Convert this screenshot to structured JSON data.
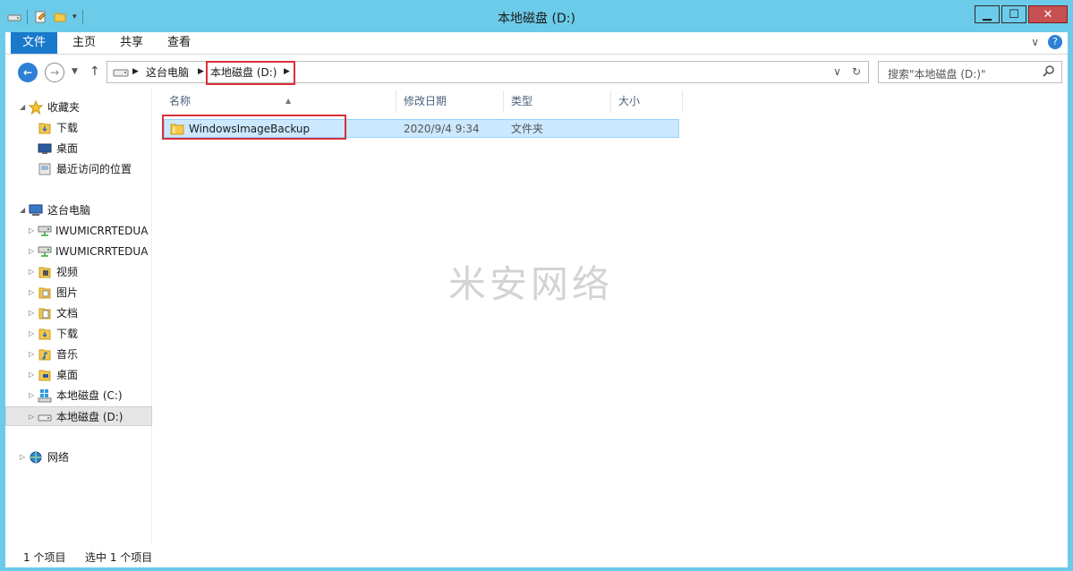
{
  "window": {
    "title": "本地磁盘 (D:)",
    "controls": {
      "minimize": "▁",
      "maximize": "☐",
      "close": "✕"
    }
  },
  "colors": {
    "titlebar": "#6ccbe8",
    "file_tab": "#1979ca",
    "selection": "#cce8ff",
    "highlight": "#d8303a"
  },
  "ribbon": {
    "tabs": [
      {
        "label": "文件",
        "active": true
      },
      {
        "label": "主页"
      },
      {
        "label": "共享"
      },
      {
        "label": "查看"
      }
    ],
    "expand_glyph": "∨",
    "help_glyph": "?"
  },
  "address": {
    "crumbs": [
      "这台电脑",
      "本地磁盘 (D:)"
    ],
    "search_placeholder": "搜索\"本地磁盘 (D:)\"",
    "dropdown_glyph": "∨",
    "refresh_glyph": "↻"
  },
  "sidebar": {
    "favorites": {
      "label": "收藏夹",
      "items": [
        "下载",
        "桌面",
        "最近访问的位置"
      ]
    },
    "this_pc": {
      "label": "这台电脑",
      "items": [
        {
          "label": "IWUMICRRTEDUA",
          "icon": "network-drive-icon"
        },
        {
          "label": "IWUMICRRTEDUA",
          "icon": "network-drive-icon"
        },
        {
          "label": "视频",
          "icon": "video-folder-icon"
        },
        {
          "label": "图片",
          "icon": "pictures-folder-icon"
        },
        {
          "label": "文档",
          "icon": "documents-folder-icon"
        },
        {
          "label": "下载",
          "icon": "downloads-folder-icon"
        },
        {
          "label": "音乐",
          "icon": "music-folder-icon"
        },
        {
          "label": "桌面",
          "icon": "desktop-folder-icon"
        },
        {
          "label": "本地磁盘 (C:)",
          "icon": "windows-drive-icon"
        },
        {
          "label": "本地磁盘 (D:)",
          "icon": "drive-icon",
          "selected": true
        }
      ]
    },
    "network": {
      "label": "网络"
    }
  },
  "file_list": {
    "columns": [
      "名称",
      "修改日期",
      "类型",
      "大小"
    ],
    "rows": [
      {
        "name": "WindowsImageBackup",
        "modified": "2020/9/4 9:34",
        "type": "文件夹",
        "size": ""
      }
    ]
  },
  "watermark": "米安网络",
  "status": {
    "count": "1 个项目",
    "selected": "选中 1 个项目"
  }
}
